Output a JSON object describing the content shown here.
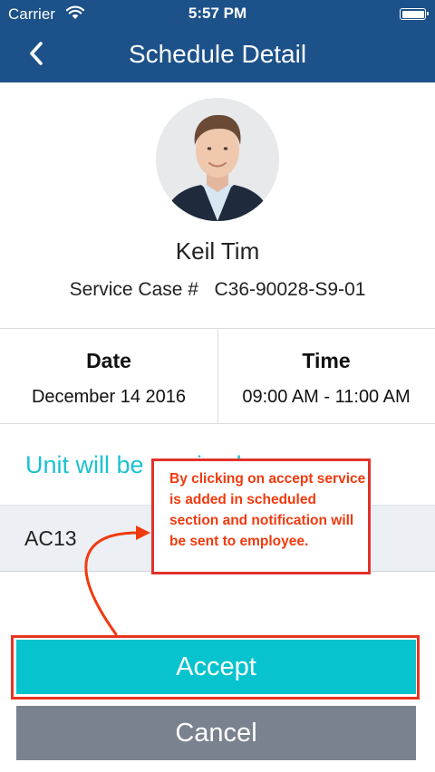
{
  "status_bar": {
    "carrier": "Carrier",
    "time": "5:57 PM",
    "wifi_icon": "wifi-icon",
    "battery_icon": "battery-icon"
  },
  "nav": {
    "title": "Schedule Detail",
    "back_icon": "chevron-left-icon"
  },
  "profile": {
    "name": "Keil Tim",
    "case_label": "Service Case #",
    "case_number": "C36-90028-S9-01",
    "case_line": "Service Case #   C36-90028-S9-01"
  },
  "schedule": {
    "date_label": "Date",
    "date_value": "December 14 2016",
    "time_label": "Time",
    "time_value": "09:00 AM - 11:00 AM"
  },
  "unit": {
    "heading": "Unit will be serviced",
    "value": "AC13"
  },
  "annotation": {
    "text": "By clicking on accept service is added in scheduled section and notification will be sent to employee."
  },
  "actions": {
    "accept_label": "Accept",
    "cancel_label": "Cancel"
  },
  "colors": {
    "nav_bar": "#1c5189",
    "accent": "#06c3cd",
    "unit_heading": "#1cc2cf",
    "cancel": "#7a8290",
    "annotation": "#e2322a"
  }
}
